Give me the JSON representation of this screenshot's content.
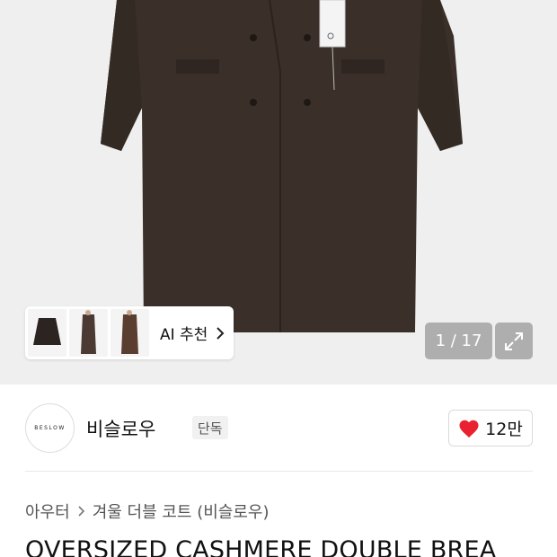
{
  "gallery": {
    "counter": "1 / 17",
    "ai_recommend_label": "AI 추천",
    "colors": {
      "background": "#efefef",
      "coat": "#3a3029"
    }
  },
  "brand": {
    "logo_text": "BESLOW",
    "name": "비슬로우",
    "badge": "단독"
  },
  "like": {
    "count": "12만",
    "heart_color": "#e8232f"
  },
  "breadcrumb": [
    "아우터",
    "겨울 더블 코트 (비슬로우)"
  ],
  "product": {
    "title": "OVERSIZED CASHMERE DOUBLE BREA"
  }
}
